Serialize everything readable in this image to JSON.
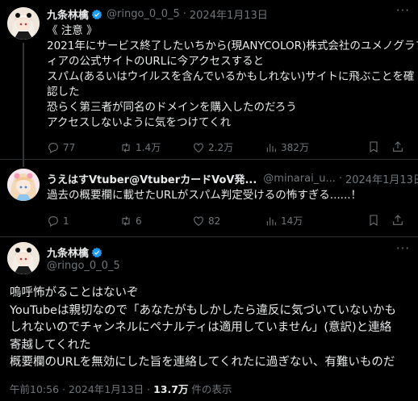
{
  "tweet1": {
    "name": "九条林檎",
    "handle": "@ringo_0_0_5",
    "date": "2024年1月13日",
    "lines": [
      "《 注意 》",
      "2021年にサービス終了したいちから(現ANYCOLOR)株式会社のユメノグラフ",
      "ィアの公式サイトのURLに今アクセスすると",
      "スパム(あるいはウイルスを含んでいるかもしれない)サイトに飛ぶことを確",
      "認した",
      "恐らく第三者が同名のドメインを購入したのだろう",
      "アクセスしないように気をつけてくれ"
    ],
    "replies": "77",
    "retweets": "1.4万",
    "likes": "2.2万",
    "views": "382万"
  },
  "tweet2": {
    "name": "うえはすVtuber@VtuberカードVoV発...",
    "handle": "@minarai_u...",
    "date": "2024年1月13日",
    "lines": [
      "過去の概要欄に載せたURLがスパム判定受けるの怖すぎる......！"
    ],
    "replies": "1",
    "retweets": "6",
    "likes": "82",
    "views": "14万"
  },
  "tweet3": {
    "name": "九条林檎",
    "handle": "@ringo_0_0_5",
    "lines": [
      "嗚呼怖がることはないぞ",
      "YouTubeは親切なので「あなたがもしかしたら違反に気づいていないかも",
      "しれないのでチャンネルにペナルティは適用していません」(意訳)と連絡",
      "寄越してくれた",
      "概要欄のURLを無効にした旨を連絡してくれたに過ぎない、有難いものだ"
    ],
    "time": "午前10:56",
    "date": "2024年1月13日",
    "views": "13.7万",
    "views_label": "件の表示"
  },
  "colors": {
    "verified": "#1d9bf0",
    "text": "#e7e9ea",
    "muted": "#71767b",
    "border": "#2f3336"
  }
}
